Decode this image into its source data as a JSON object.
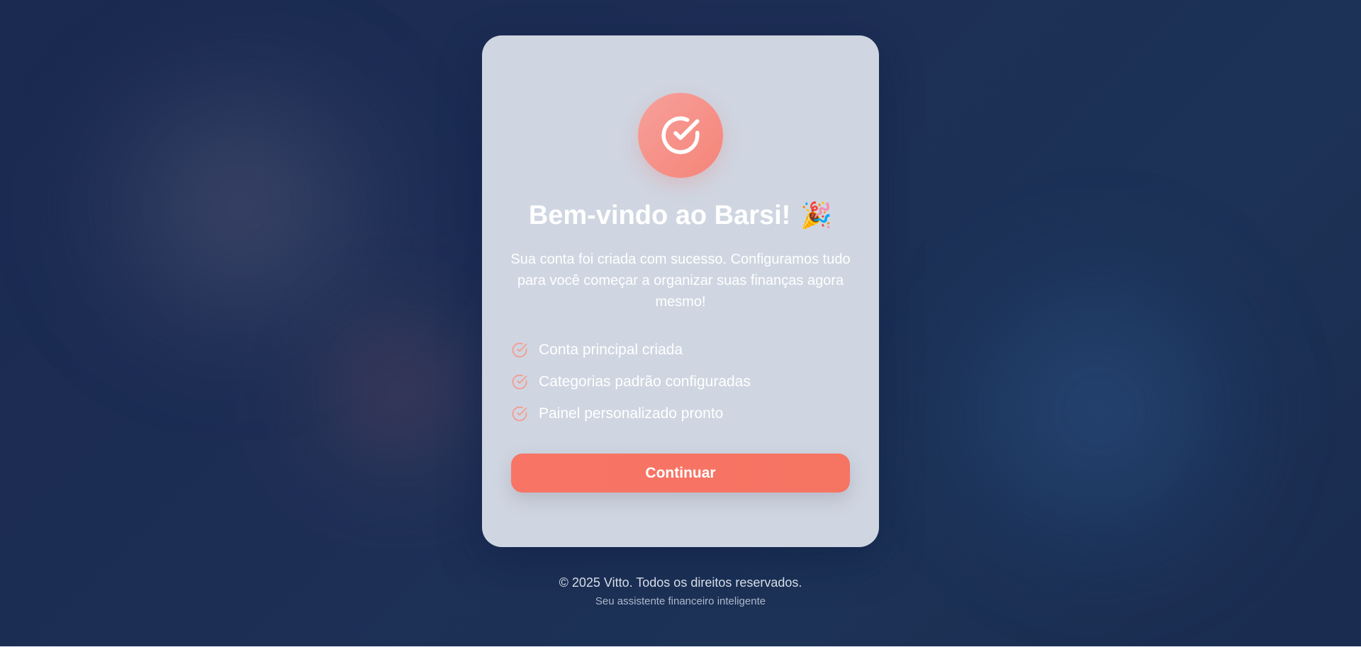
{
  "card": {
    "badge_icon": "check-circle-icon",
    "title": "Bem-vindo ao Barsi!",
    "title_emoji": "🎉",
    "subtitle": "Sua conta foi criada com sucesso. Configuramos tudo para você começar a organizar suas finanças agora mesmo!",
    "checklist": [
      {
        "icon": "check-circle-icon",
        "label": "Conta principal criada"
      },
      {
        "icon": "check-circle-icon",
        "label": "Categorias padrão configuradas"
      },
      {
        "icon": "check-circle-icon",
        "label": "Painel personalizado pronto"
      }
    ],
    "continue_label": "Continuar"
  },
  "footer": {
    "copyright": "© 2025 Vitto. Todos os direitos reservados.",
    "tagline": "Seu assistente financeiro inteligente"
  },
  "colors": {
    "accent": "#f67462",
    "badge": "#f58478",
    "card_bg": "#d6dde7",
    "page_bg": "#1a2a50"
  }
}
